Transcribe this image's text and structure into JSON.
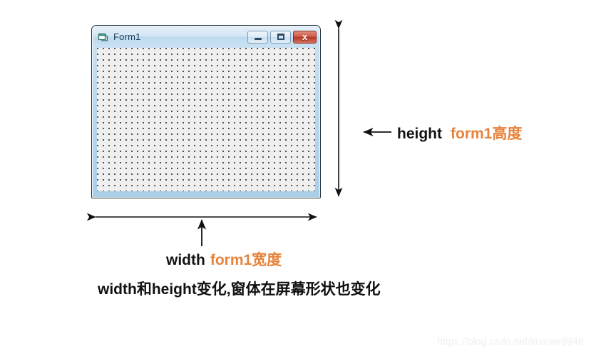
{
  "form": {
    "title": "Form1",
    "title_icon": "form-window-icon",
    "buttons": {
      "minimize": {
        "name": "minimize-button",
        "glyph": "minimize-icon",
        "label": ""
      },
      "maximize": {
        "name": "maximize-button",
        "glyph": "maximize-icon",
        "label": ""
      },
      "close": {
        "name": "close-button",
        "glyph": "close-icon",
        "label": "x"
      }
    },
    "client_area": "designer-dot-grid"
  },
  "annotations": {
    "height": {
      "arrow": "left-arrow-icon",
      "term": "height",
      "accent": "form1高度"
    },
    "width": {
      "arrow": "up-arrow-icon",
      "term": "width",
      "accent": "form1宽度"
    },
    "caption": "width和height变化,窗体在屏幕形状也变化",
    "vertical_measure_arrow": "vertical-double-arrow-icon",
    "horizontal_measure_arrow": "horizontal-double-arrow-icon"
  },
  "watermark": "https://blog.csdn.net/linaner8946",
  "colors": {
    "accent_orange": "#e8823a",
    "text_black": "#121212",
    "form_frame_blue": "#a9cfe8",
    "form_border": "#25323c",
    "close_red": "#b53a27",
    "grid_background": "#efefef",
    "watermark_gray": "#efefef"
  }
}
